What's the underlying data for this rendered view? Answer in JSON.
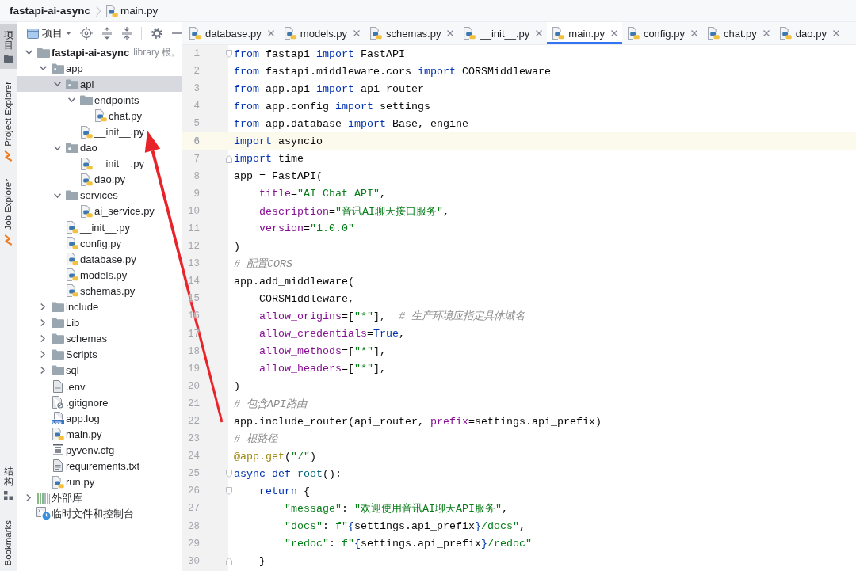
{
  "breadcrumb": [
    {
      "label": "fastapi-ai-async",
      "kind": "project"
    },
    {
      "label": "main.py",
      "kind": "python"
    }
  ],
  "tool_strip": {
    "top": [
      {
        "label": "项目",
        "kind": "project",
        "selected": true
      },
      {
        "label": "Project Explorer",
        "kind": "explorer",
        "selected": false
      },
      {
        "label": "Job Explorer",
        "kind": "explorer",
        "selected": false
      }
    ],
    "bottom": [
      {
        "label": "结构",
        "kind": "structure",
        "selected": false
      },
      {
        "label": "Bookmarks",
        "kind": "bookmarks",
        "selected": false
      }
    ]
  },
  "project_panel": {
    "view": "项目",
    "tree": [
      {
        "label": "fastapi-ai-async",
        "detail": "library 根,",
        "kind": "project",
        "expanded": true,
        "selected": false,
        "children": [
          {
            "label": "app",
            "kind": "package",
            "expanded": true,
            "selected": false,
            "children": [
              {
                "label": "api",
                "kind": "package",
                "expanded": true,
                "selected": true,
                "children": [
                  {
                    "label": "endpoints",
                    "kind": "folder",
                    "expanded": true,
                    "selected": false,
                    "children": [
                      {
                        "label": "chat.py",
                        "kind": "python",
                        "selected": false
                      }
                    ]
                  },
                  {
                    "label": "__init__.py",
                    "kind": "python",
                    "selected": false
                  }
                ]
              },
              {
                "label": "dao",
                "kind": "package",
                "expanded": true,
                "selected": false,
                "children": [
                  {
                    "label": "__init__.py",
                    "kind": "python",
                    "selected": false
                  },
                  {
                    "label": "dao.py",
                    "kind": "python",
                    "selected": false
                  }
                ]
              },
              {
                "label": "services",
                "kind": "folder",
                "expanded": true,
                "selected": false,
                "children": [
                  {
                    "label": "ai_service.py",
                    "kind": "python",
                    "selected": false
                  }
                ]
              },
              {
                "label": "__init__.py",
                "kind": "python",
                "selected": false
              },
              {
                "label": "config.py",
                "kind": "python",
                "selected": false
              },
              {
                "label": "database.py",
                "kind": "python",
                "selected": false
              },
              {
                "label": "models.py",
                "kind": "python",
                "selected": false
              },
              {
                "label": "schemas.py",
                "kind": "python",
                "selected": false
              }
            ]
          },
          {
            "label": "include",
            "kind": "folder",
            "expanded": false,
            "selected": false
          },
          {
            "label": "Lib",
            "kind": "folder",
            "expanded": false,
            "selected": false
          },
          {
            "label": "schemas",
            "kind": "folder",
            "expanded": false,
            "selected": false
          },
          {
            "label": "Scripts",
            "kind": "folder",
            "expanded": false,
            "selected": false
          },
          {
            "label": "sql",
            "kind": "folder",
            "expanded": false,
            "selected": false
          },
          {
            "label": ".env",
            "kind": "text",
            "selected": false
          },
          {
            "label": ".gitignore",
            "kind": "ignore",
            "selected": false
          },
          {
            "label": "app.log",
            "kind": "log",
            "selected": false
          },
          {
            "label": "main.py",
            "kind": "python",
            "selected": false
          },
          {
            "label": "pyvenv.cfg",
            "kind": "config",
            "selected": false
          },
          {
            "label": "requirements.txt",
            "kind": "text",
            "selected": false
          },
          {
            "label": "run.py",
            "kind": "python",
            "selected": false
          }
        ]
      },
      {
        "label": "外部库",
        "kind": "library",
        "expanded": false,
        "selected": false
      },
      {
        "label": "临时文件和控制台",
        "kind": "scratches",
        "selected": false
      }
    ]
  },
  "editor": {
    "tabs": [
      {
        "label": "database.py",
        "selected": false
      },
      {
        "label": "models.py",
        "selected": false
      },
      {
        "label": "schemas.py",
        "selected": false
      },
      {
        "label": "__init__.py",
        "selected": false
      },
      {
        "label": "main.py",
        "selected": true
      },
      {
        "label": "config.py",
        "selected": false
      },
      {
        "label": "chat.py",
        "selected": false
      },
      {
        "label": "dao.py",
        "selected": false
      }
    ],
    "lines": [
      {
        "number": "1",
        "current": false,
        "fold_start": true,
        "fold_end": false,
        "tokens": [
          {
            "kind": "keyword",
            "text": "from"
          },
          {
            "kind": "plain",
            "text": " fastapi "
          },
          {
            "kind": "keyword",
            "text": "import"
          },
          {
            "kind": "plain",
            "text": " FastAPI"
          }
        ]
      },
      {
        "number": "2",
        "current": false,
        "fold_start": false,
        "fold_end": false,
        "tokens": [
          {
            "kind": "keyword",
            "text": "from"
          },
          {
            "kind": "plain",
            "text": " fastapi.middleware.cors "
          },
          {
            "kind": "keyword",
            "text": "import"
          },
          {
            "kind": "plain",
            "text": " CORSMiddleware"
          }
        ]
      },
      {
        "number": "3",
        "current": false,
        "fold_start": false,
        "fold_end": false,
        "tokens": [
          {
            "kind": "keyword",
            "text": "from"
          },
          {
            "kind": "plain",
            "text": " app.api "
          },
          {
            "kind": "keyword",
            "text": "import"
          },
          {
            "kind": "plain",
            "text": " api_router"
          }
        ]
      },
      {
        "number": "4",
        "current": false,
        "fold_start": false,
        "fold_end": false,
        "tokens": [
          {
            "kind": "keyword",
            "text": "from"
          },
          {
            "kind": "plain",
            "text": " app.config "
          },
          {
            "kind": "keyword",
            "text": "import"
          },
          {
            "kind": "plain",
            "text": " settings"
          }
        ]
      },
      {
        "number": "5",
        "current": false,
        "fold_start": false,
        "fold_end": false,
        "tokens": [
          {
            "kind": "keyword",
            "text": "from"
          },
          {
            "kind": "plain",
            "text": " app.database "
          },
          {
            "kind": "keyword",
            "text": "import"
          },
          {
            "kind": "plain",
            "text": " Base, engine"
          }
        ]
      },
      {
        "number": "6",
        "current": true,
        "fold_start": false,
        "fold_end": false,
        "tokens": [
          {
            "kind": "keyword",
            "text": "import"
          },
          {
            "kind": "plain",
            "text": " asyncio"
          }
        ]
      },
      {
        "number": "7",
        "current": false,
        "fold_start": false,
        "fold_end": true,
        "tokens": [
          {
            "kind": "keyword",
            "text": "import"
          },
          {
            "kind": "plain",
            "text": " time"
          }
        ]
      },
      {
        "number": "8",
        "current": false,
        "fold_start": false,
        "fold_end": false,
        "tokens": [
          {
            "kind": "plain",
            "text": "app = FastAPI("
          }
        ],
        "children": [
          {
            "number": "9",
            "current": false,
            "fold_start": false,
            "fold_end": false,
            "tokens": [
              {
                "kind": "param",
                "text": "title"
              },
              {
                "kind": "plain",
                "text": "="
              },
              {
                "kind": "string",
                "text": "\"AI Chat API\""
              },
              {
                "kind": "plain",
                "text": ","
              }
            ]
          },
          {
            "number": "10",
            "current": false,
            "fold_start": false,
            "fold_end": false,
            "tokens": [
              {
                "kind": "param",
                "text": "description"
              },
              {
                "kind": "plain",
                "text": "="
              },
              {
                "kind": "string",
                "text": "\"音讯AI聊天接口服务\""
              },
              {
                "kind": "plain",
                "text": ","
              }
            ]
          },
          {
            "number": "11",
            "current": false,
            "fold_start": false,
            "fold_end": false,
            "tokens": [
              {
                "kind": "param",
                "text": "version"
              },
              {
                "kind": "plain",
                "text": "="
              },
              {
                "kind": "string",
                "text": "\"1.0.0\""
              }
            ]
          }
        ]
      },
      {
        "number": "12",
        "current": false,
        "fold_start": false,
        "fold_end": false,
        "tokens": [
          {
            "kind": "plain",
            "text": ")"
          }
        ]
      },
      {
        "number": "13",
        "current": false,
        "fold_start": false,
        "fold_end": false,
        "tokens": [
          {
            "kind": "comment",
            "text": "# 配置CORS"
          }
        ]
      },
      {
        "number": "14",
        "current": false,
        "fold_start": false,
        "fold_end": false,
        "tokens": [
          {
            "kind": "plain",
            "text": "app.add_middleware("
          }
        ],
        "children": [
          {
            "number": "15",
            "current": false,
            "fold_start": false,
            "fold_end": false,
            "tokens": [
              {
                "kind": "plain",
                "text": "CORSMiddleware,"
              }
            ]
          },
          {
            "number": "16",
            "current": false,
            "fold_start": false,
            "fold_end": false,
            "tokens": [
              {
                "kind": "param",
                "text": "allow_origins"
              },
              {
                "kind": "plain",
                "text": "=["
              },
              {
                "kind": "string",
                "text": "\"*\""
              },
              {
                "kind": "plain",
                "text": "],  "
              },
              {
                "kind": "comment",
                "text": "# 生产环境应指定具体域名"
              }
            ]
          },
          {
            "number": "17",
            "current": false,
            "fold_start": false,
            "fold_end": false,
            "tokens": [
              {
                "kind": "param",
                "text": "allow_credentials"
              },
              {
                "kind": "plain",
                "text": "="
              },
              {
                "kind": "keyword",
                "text": "True"
              },
              {
                "kind": "plain",
                "text": ","
              }
            ]
          },
          {
            "number": "18",
            "current": false,
            "fold_start": false,
            "fold_end": false,
            "tokens": [
              {
                "kind": "param",
                "text": "allow_methods"
              },
              {
                "kind": "plain",
                "text": "=["
              },
              {
                "kind": "string",
                "text": "\"*\""
              },
              {
                "kind": "plain",
                "text": "],"
              }
            ]
          },
          {
            "number": "19",
            "current": false,
            "fold_start": false,
            "fold_end": false,
            "tokens": [
              {
                "kind": "param",
                "text": "allow_headers"
              },
              {
                "kind": "plain",
                "text": "=["
              },
              {
                "kind": "string",
                "text": "\"*\""
              },
              {
                "kind": "plain",
                "text": "],"
              }
            ]
          }
        ]
      },
      {
        "number": "20",
        "current": false,
        "fold_start": false,
        "fold_end": false,
        "tokens": [
          {
            "kind": "plain",
            "text": ")"
          }
        ]
      },
      {
        "number": "21",
        "current": false,
        "fold_start": false,
        "fold_end": false,
        "tokens": [
          {
            "kind": "comment",
            "text": "# 包含API路由"
          }
        ]
      },
      {
        "number": "22",
        "current": false,
        "fold_start": false,
        "fold_end": false,
        "tokens": [
          {
            "kind": "plain",
            "text": "app.include_router(api_router, "
          },
          {
            "kind": "param",
            "text": "prefix"
          },
          {
            "kind": "plain",
            "text": "=settings.api_prefix)"
          }
        ]
      },
      {
        "number": "23",
        "current": false,
        "fold_start": false,
        "fold_end": false,
        "tokens": [
          {
            "kind": "comment",
            "text": "# 根路径"
          }
        ]
      },
      {
        "number": "24",
        "current": false,
        "fold_start": false,
        "fold_end": false,
        "tokens": [
          {
            "kind": "decorator",
            "text": "@app.get"
          },
          {
            "kind": "plain",
            "text": "("
          },
          {
            "kind": "string",
            "text": "\"/\""
          },
          {
            "kind": "plain",
            "text": ")"
          }
        ]
      },
      {
        "number": "25",
        "current": false,
        "fold_start": true,
        "fold_end": false,
        "tokens": [
          {
            "kind": "keyword",
            "text": "async def"
          },
          {
            "kind": "function",
            "text": " root"
          },
          {
            "kind": "plain",
            "text": "():"
          }
        ],
        "children": [
          {
            "number": "26",
            "current": false,
            "fold_start": true,
            "fold_end": false,
            "tokens": [
              {
                "kind": "keyword",
                "text": "return"
              },
              {
                "kind": "plain",
                "text": " {"
              }
            ],
            "children": [
              {
                "number": "27",
                "current": false,
                "fold_start": false,
                "fold_end": false,
                "tokens": [
                  {
                    "kind": "string",
                    "text": "\"message\""
                  },
                  {
                    "kind": "plain",
                    "text": ": "
                  },
                  {
                    "kind": "string",
                    "text": "\"欢迎使用音讯AI聊天API服务\""
                  },
                  {
                    "kind": "plain",
                    "text": ","
                  }
                ]
              },
              {
                "number": "28",
                "current": false,
                "fold_start": false,
                "fold_end": false,
                "tokens": [
                  {
                    "kind": "string",
                    "text": "\"docs\""
                  },
                  {
                    "kind": "plain",
                    "text": ": "
                  },
                  {
                    "kind": "string",
                    "text": "f\""
                  },
                  {
                    "kind": "brace",
                    "text": "{"
                  },
                  {
                    "kind": "plain",
                    "text": "settings.api_prefix"
                  },
                  {
                    "kind": "brace",
                    "text": "}"
                  },
                  {
                    "kind": "string",
                    "text": "/docs\""
                  },
                  {
                    "kind": "plain",
                    "text": ","
                  }
                ]
              },
              {
                "number": "29",
                "current": false,
                "fold_start": false,
                "fold_end": false,
                "tokens": [
                  {
                    "kind": "string",
                    "text": "\"redoc\""
                  },
                  {
                    "kind": "plain",
                    "text": ": "
                  },
                  {
                    "kind": "string",
                    "text": "f\""
                  },
                  {
                    "kind": "brace",
                    "text": "{"
                  },
                  {
                    "kind": "plain",
                    "text": "settings.api_prefix"
                  },
                  {
                    "kind": "brace",
                    "text": "}"
                  },
                  {
                    "kind": "string",
                    "text": "/redoc\""
                  }
                ]
              }
            ]
          },
          {
            "number": "30",
            "current": false,
            "fold_start": false,
            "fold_end": true,
            "tokens": [
              {
                "kind": "plain",
                "text": "}"
              }
            ]
          }
        ]
      }
    ]
  },
  "annotations": [
    {
      "kind": "arrow"
    }
  ]
}
